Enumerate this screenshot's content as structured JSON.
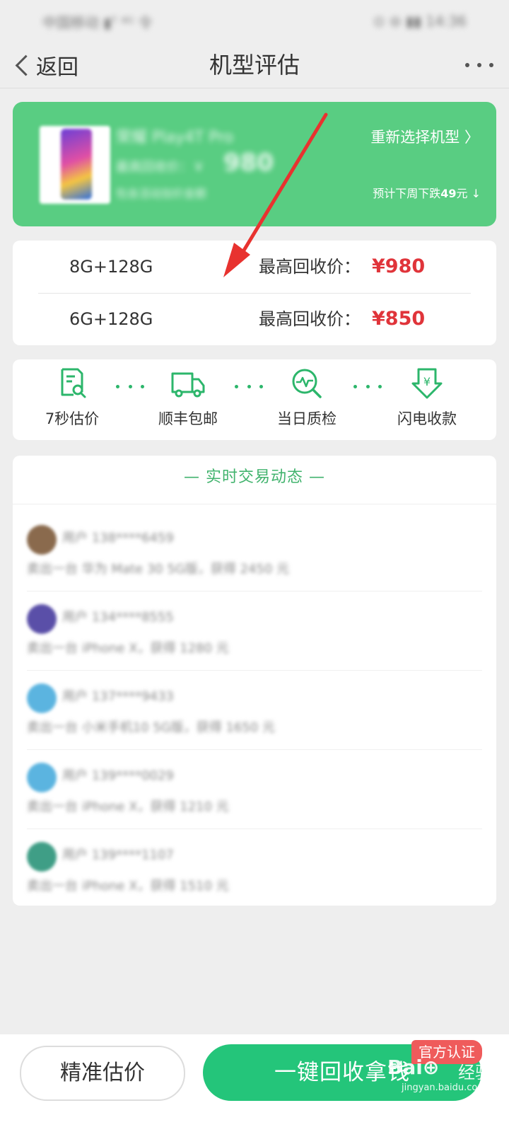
{
  "status_bar": {
    "left": "中国移动 ▮ᵀ ⁴ᴳ 令",
    "right": "⊙ ⊖ ▮▮ 14:36"
  },
  "nav": {
    "back_label": "返回",
    "title": "机型评估"
  },
  "device": {
    "name": "荣耀 Play4T Pro",
    "price_prefix": "最高回收价：￥",
    "price": "980",
    "note": "包含活动加价金额",
    "reselect_label": "重新选择机型 〉",
    "trend_prefix": "预计下周下跌",
    "trend_amount": "49",
    "trend_suffix": "元 ↓"
  },
  "prices": [
    {
      "spec": "8G+128G",
      "label": "最高回收价：",
      "value": "¥980"
    },
    {
      "spec": "6G+128G",
      "label": "最高回收价：",
      "value": "¥850"
    }
  ],
  "features": [
    {
      "label": "7秒估价",
      "icon": "document-search-icon"
    },
    {
      "label": "顺丰包邮",
      "icon": "truck-icon"
    },
    {
      "label": "当日质检",
      "icon": "inspection-icon"
    },
    {
      "label": "闪电收款",
      "icon": "yuan-download-icon"
    }
  ],
  "feed": {
    "title": "— 实时交易动态 —",
    "items": [
      {
        "user": "用户 138****6459",
        "desc": "卖出一台 华为 Mate 30 5G版，获得 2450 元"
      },
      {
        "user": "用户 134****8555",
        "desc": "卖出一台 iPhone X，获得 1280 元"
      },
      {
        "user": "用户 137****9433",
        "desc": "卖出一台 小米手机10 5G版，获得 1650 元"
      },
      {
        "user": "用户 139****0029",
        "desc": "卖出一台 iPhone X，获得 1210 元"
      },
      {
        "user": "用户 139****1107",
        "desc": "卖出一台 iPhone X，获得 1510 元"
      }
    ]
  },
  "bottom": {
    "estimate_label": "精准估价",
    "recycle_label": "一键回收拿钱",
    "badge_label": "官方认证"
  },
  "watermark": {
    "logo": "Bai⊕",
    "text": "经验",
    "url": "jingyan.baidu.com"
  },
  "colors": {
    "accent": "#59cd82",
    "button_green": "#24c57a",
    "price_red": "#e0343a",
    "arrow_red": "#e8322f"
  }
}
